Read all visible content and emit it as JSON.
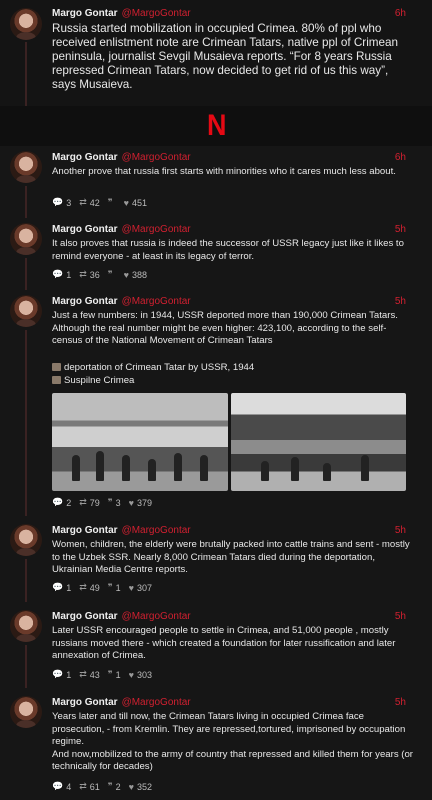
{
  "tweets": [
    {
      "name": "Margo Gontar",
      "handle": "@MargoGontar",
      "time": "6h",
      "text": "Russia started mobilization in occupied Crimea. 80% of ppl who received enlistment note are Crimean Tatars, native ppl of Crimean peninsula, journalist Sevgil Musaieva reports. “For 8 years  Russia repressed Crimean Tatars, now decided to get rid of us this way”, says Musaieva."
    },
    {
      "name": "Margo Gontar",
      "handle": "@MargoGontar",
      "time": "6h",
      "text": "Another prove that russia first starts with minorities who it cares much less about.",
      "replies": "3",
      "retweets": "42",
      "quotes": "",
      "likes": "451"
    },
    {
      "name": "Margo Gontar",
      "handle": "@MargoGontar",
      "time": "5h",
      "text": "It also proves that russia is indeed the successor of USSR legacy just like it likes to remind everyone - at least in its legacy of terror.",
      "replies": "1",
      "retweets": "36",
      "quotes": "",
      "likes": "388"
    },
    {
      "name": "Margo Gontar",
      "handle": "@MargoGontar",
      "time": "5h",
      "text": "Just a few numbers: in 1944, USSR deported more than 190,000 Crimean Tatars. Although the real number might be even higher: 423,100, according to the self-census of the National Movement of Crimean Tatars",
      "caption1": "deportation of Crimean Tatar by USSR, 1944",
      "caption2": "Suspilne Crimea",
      "replies": "2",
      "retweets": "79",
      "quotes": "3",
      "likes": "379"
    },
    {
      "name": "Margo Gontar",
      "handle": "@MargoGontar",
      "time": "5h",
      "text": "Women, children, the elderly were brutally packed into cattle trains and sent - mostly to the Uzbek SSR. Nearly 8,000 Crimean Tatars died during the deportation, Ukrainian Media Centre reports.",
      "replies": "1",
      "retweets": "49",
      "quotes": "1",
      "likes": "307"
    },
    {
      "name": "Margo Gontar",
      "handle": "@MargoGontar",
      "time": "5h",
      "text": "Later USSR encouraged people to settle in Crimea, and 51,000 people , mostly russians moved there - which created a foundation for later russification and later annexation of Crimea.",
      "replies": "1",
      "retweets": "43",
      "quotes": "1",
      "likes": "303"
    },
    {
      "name": "Margo Gontar",
      "handle": "@MargoGontar",
      "time": "5h",
      "text1": "Years later and till now, the Crimean Tatars living in occupied Crimea face prosecution, -  from Kremlin. They are  repressed,tortured,  imprisoned by occupation regime.",
      "text2": "And now,mobilized to the army of country that repressed and killed them for years (or technically for decades)",
      "replies": "4",
      "retweets": "61",
      "quotes": "2",
      "likes": "352"
    }
  ],
  "logo": "N",
  "colors": {
    "accent": "#d02030",
    "logo": "#e50914",
    "background": "#161616"
  },
  "icons": {
    "reply": "speech-bubble-icon",
    "retweet": "retweet-icon",
    "quote": "quote-icon",
    "like": "heart-icon"
  }
}
